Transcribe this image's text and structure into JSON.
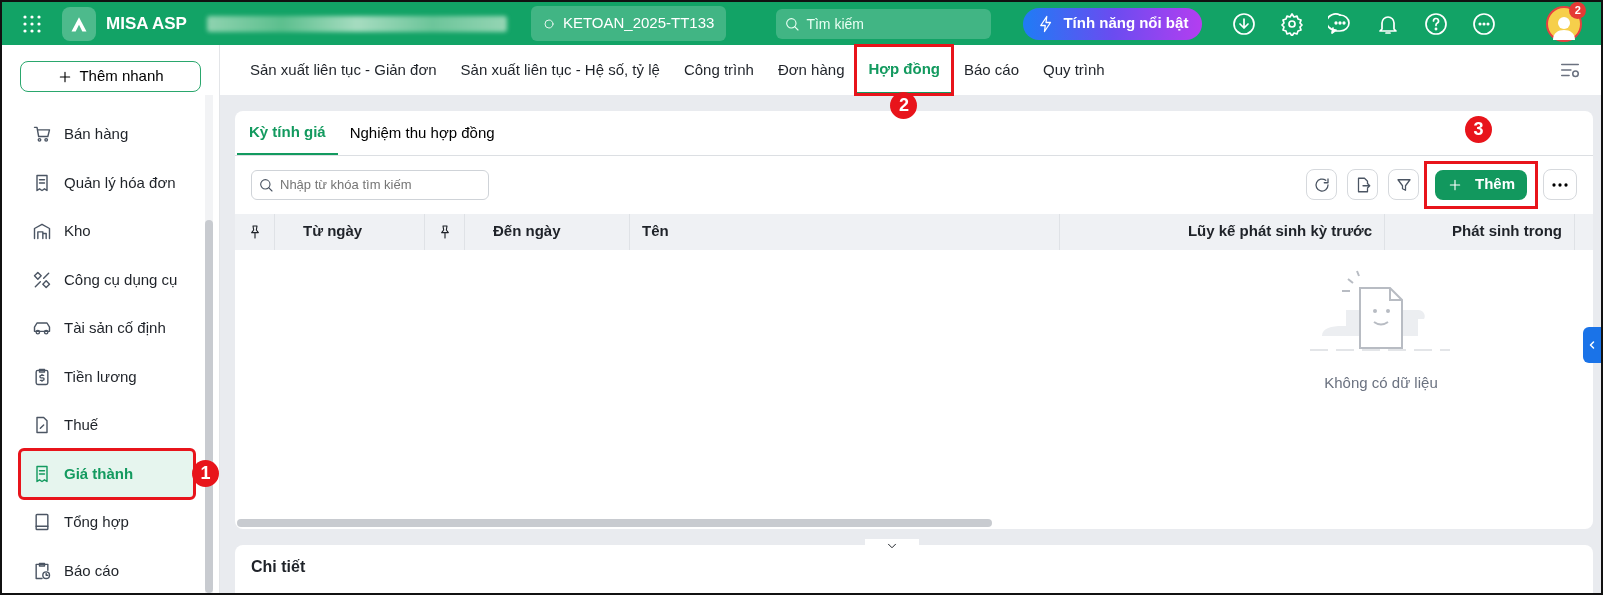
{
  "header": {
    "app_name": "MISA ASP",
    "database": "KETOAN_2025-TT133",
    "search_placeholder": "Tìm kiếm",
    "feature_button": "Tính năng nổi bật",
    "avatar_badge": "2"
  },
  "sidebar": {
    "quick_add": "Thêm nhanh",
    "items": [
      {
        "label": "Bán hàng",
        "selected": false
      },
      {
        "label": "Quản lý hóa đơn",
        "selected": false
      },
      {
        "label": "Kho",
        "selected": false
      },
      {
        "label": "Công cụ dụng cụ",
        "selected": false
      },
      {
        "label": "Tài sản cố định",
        "selected": false
      },
      {
        "label": "Tiền lương",
        "selected": false
      },
      {
        "label": "Thuế",
        "selected": false
      },
      {
        "label": "Giá thành",
        "selected": true,
        "marker": "1"
      },
      {
        "label": "Tổng hợp",
        "selected": false
      },
      {
        "label": "Báo cáo",
        "selected": false
      }
    ]
  },
  "module_tabs": [
    {
      "label": "Sản xuất liên tục - Giản đơn",
      "selected": false
    },
    {
      "label": "Sản xuất liên tục - Hệ số, tỷ lệ",
      "selected": false
    },
    {
      "label": "Công trình",
      "selected": false
    },
    {
      "label": "Đơn hàng",
      "selected": false
    },
    {
      "label": "Hợp đồng",
      "selected": true,
      "marker": "2"
    },
    {
      "label": "Báo cáo",
      "selected": false
    },
    {
      "label": "Quy trình",
      "selected": false
    }
  ],
  "sub_tabs": [
    {
      "label": "Kỳ tính giá",
      "selected": true
    },
    {
      "label": "Nghiệm thu hợp đồng",
      "selected": false
    }
  ],
  "toolbar": {
    "search_placeholder": "Nhập từ khóa tìm kiếm",
    "add_button": {
      "label": "Thêm",
      "marker": "3"
    }
  },
  "table": {
    "columns": [
      {
        "label": "Từ ngày",
        "pin": true
      },
      {
        "label": "Đến ngày",
        "pin": true
      },
      {
        "label": "Tên",
        "pin": false
      },
      {
        "label": "Lũy kế phát sinh kỳ trước",
        "pin": false
      },
      {
        "label": "Phát sinh trong",
        "pin": false
      }
    ],
    "empty_text": "Không có dữ liệu"
  },
  "detail_panel": {
    "title": "Chi tiết"
  }
}
